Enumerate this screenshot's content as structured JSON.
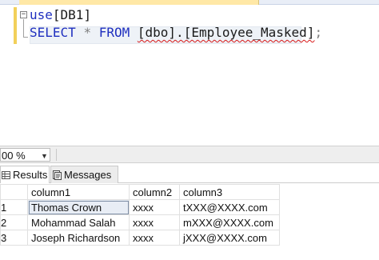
{
  "editor": {
    "line1": {
      "keyword": "use",
      "rest": "[DB1]"
    },
    "line2": {
      "select": "SELECT",
      "star": "*",
      "from": "FROM",
      "object": "[dbo].[Employee_Masked]",
      "terminator": ";"
    }
  },
  "zoom": {
    "value": "00 %"
  },
  "tabs": {
    "results": "Results",
    "messages": "Messages"
  },
  "grid": {
    "columns": [
      "column1",
      "column2",
      "column3"
    ],
    "rows": [
      {
        "index": "1",
        "cells": [
          "Thomas Crown",
          "xxxx",
          "tXXX@XXXX.com"
        ]
      },
      {
        "index": "2",
        "cells": [
          "Mohammad Salah",
          "xxxx",
          "mXXX@XXXX.com"
        ]
      },
      {
        "index": "3",
        "cells": [
          "Joseph Richardson",
          "xxxx",
          "jXXX@XXXX.com"
        ]
      }
    ]
  },
  "colors": {
    "keyword": "#1f2fbf",
    "error_squiggle": "#d81818",
    "gutter_marker": "#f2d05a"
  },
  "icons": {
    "results_tab": "grid-icon",
    "messages_tab": "messages-icon",
    "zoom_dropdown": "chevron-down-icon"
  }
}
